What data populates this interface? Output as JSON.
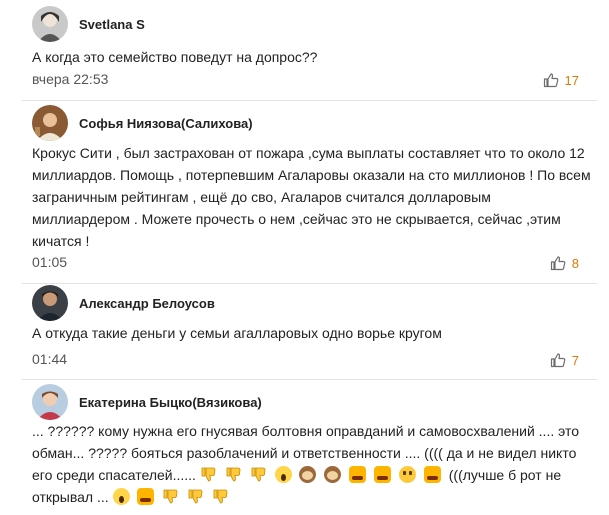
{
  "comments": [
    {
      "author": "Svetlana S",
      "text": "А когда это семейство поведут на допрос??",
      "time": "вчера 22:53",
      "likes": "17"
    },
    {
      "author": "Софья Ниязова(Салихова)",
      "text": "Крокус Сити , был застрахован от пожара ,сума выплаты составляет что то около 12 миллиардов. Помощь , потерпевшим Агаларовы оказали на сто миллионов ! По всем заграничным рейтингам , ещё до сво, Агаларов считался долларовым миллиардером . Можете прочесть о нем ,сейчас это не скрывается, сейчас ,этим кичатся !",
      "time": "01:05",
      "likes": "8"
    },
    {
      "author": "Александр Белоусов",
      "text": "А откуда такие деньги у семьи агалларовых одно ворье кругом",
      "time": "01:44",
      "likes": "7"
    },
    {
      "author": "Екатерина Быцко(Вязикова)",
      "text_part1": "... ?????? кому нужна его гнусявая болтовня оправданий и самовосхвалений .... это обман... ????? бояться разоблачений и ответственности .... (((( да и не видел никто его среди спасателей......",
      "text_part2": "(((лучше б рот не открывал ..."
    }
  ],
  "colors": {
    "accent": "#e07a00",
    "divider": "#e3e3e3",
    "text": "#222222",
    "meta": "#555555"
  },
  "icons": {
    "like": "thumbs-up-icon",
    "emoji_down": "thumbs-down-emoji"
  }
}
